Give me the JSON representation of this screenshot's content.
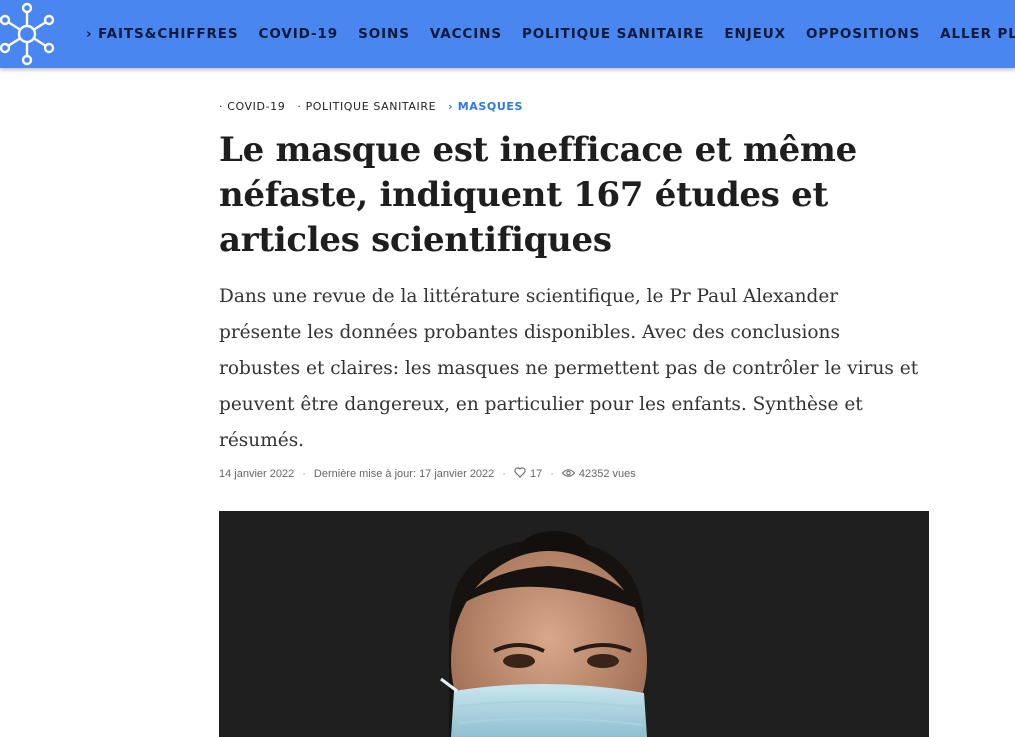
{
  "nav": {
    "items": [
      "FAITS&CHIFFRES",
      "COVID-19",
      "SOINS",
      "VACCINS",
      "POLITIQUE SANITAIRE",
      "ENJEUX",
      "OPPOSITIONS",
      "ALLER PLUS LOIN"
    ]
  },
  "article": {
    "breadcrumbs": [
      "COVID-19",
      "POLITIQUE SANITAIRE",
      "MASQUES"
    ],
    "title": "Le masque est inefficace et même néfaste, indiquent 167 études et articles scientifiques",
    "lead": "Dans une revue de la littérature scientifique, le Pr Paul Alexander présente les données probantes disponibles. Avec des conclusions robustes et claires: les masques ne permettent pas de contrôler le virus et peuvent être dangereux, en particulier pour les enfants. Synthèse et résumés.",
    "date": "14 janvier 2022",
    "updated_label": "Dernière mise à jour:",
    "updated_date": "17 janvier 2022",
    "likes": "17",
    "views": "42352 vues"
  },
  "icons": {
    "logo": "network-molecule-icon",
    "likes": "heart-icon",
    "views": "eye-icon"
  },
  "colors": {
    "topbar": "#4a86f0",
    "accent": "#2f7ae0"
  }
}
